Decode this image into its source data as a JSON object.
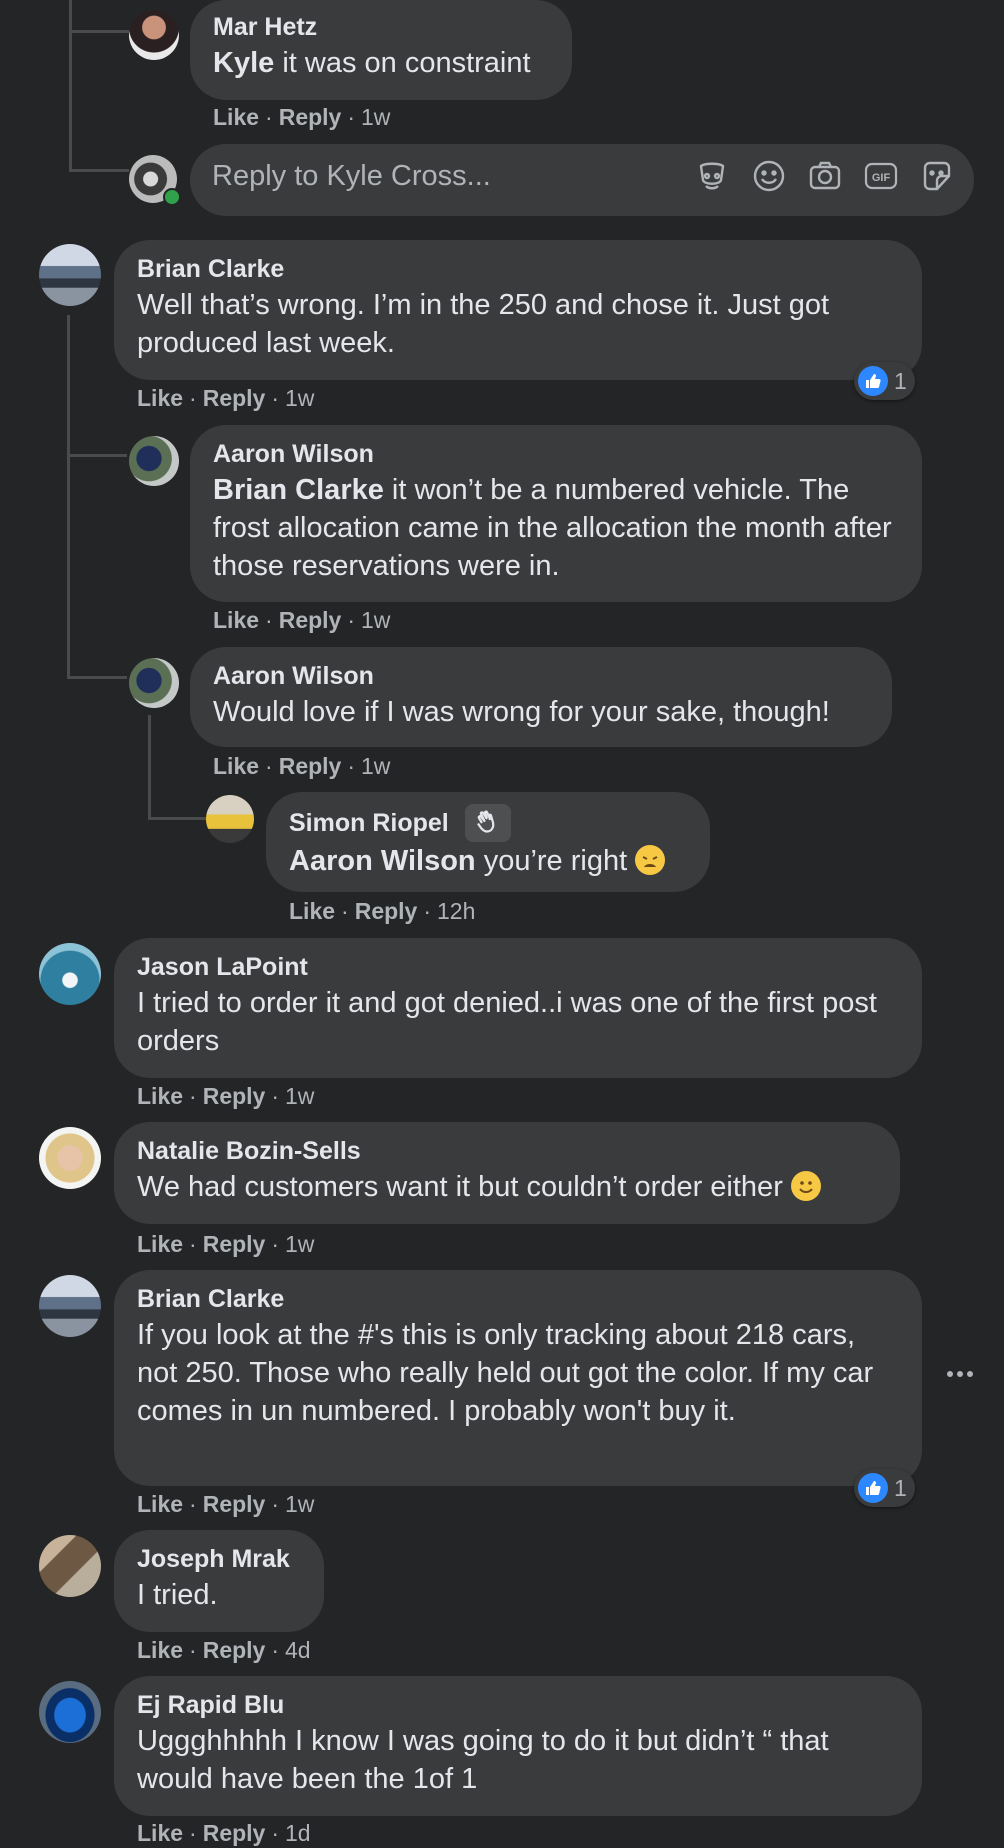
{
  "reply_box": {
    "placeholder": "Reply to Kyle Cross..."
  },
  "icons": [
    "avatar-icon",
    "emoji-icon",
    "camera-icon",
    "gif-icon",
    "sticker-icon",
    "like-icon",
    "more-icon"
  ],
  "colors": {
    "background": "#242526",
    "bubble": "#3a3b3c",
    "meta": "#b0b3b8",
    "accent": "#2d88ff"
  },
  "comments": [
    {
      "name": "Mar Hetz",
      "mention": "Kyle",
      "text": " it was on constraint",
      "meta": {
        "like": "Like",
        "reply": "Reply",
        "time": "1w"
      }
    },
    {
      "name": "Brian Clarke",
      "text": "Well that’s wrong. I’m in the 250 and chose it. Just got produced last week.",
      "meta": {
        "like": "Like",
        "reply": "Reply",
        "time": "1w"
      },
      "reactions": "1"
    },
    {
      "name": "Aaron Wilson",
      "mention": "Brian Clarke",
      "text": " it won’t be a numbered vehicle. The frost allocation came in the allocation the month after those reservations were in.",
      "meta": {
        "like": "Like",
        "reply": "Reply",
        "time": "1w"
      }
    },
    {
      "name": "Aaron Wilson",
      "text": "Would love if I was wrong for your sake, though!",
      "meta": {
        "like": "Like",
        "reply": "Reply",
        "time": "1w"
      }
    },
    {
      "name": "Simon Riopel",
      "mention": "Aaron Wilson",
      "text": " you’re right",
      "meta": {
        "like": "Like",
        "reply": "Reply",
        "time": "12h"
      }
    },
    {
      "name": "Jason LaPoint",
      "text": "I tried to order it and got denied..i was one of the first post orders",
      "meta": {
        "like": "Like",
        "reply": "Reply",
        "time": "1w"
      }
    },
    {
      "name": "Natalie Bozin-Sells",
      "text": "We had customers want it but couldn’t order either",
      "meta": {
        "like": "Like",
        "reply": "Reply",
        "time": "1w"
      }
    },
    {
      "name": "Brian Clarke",
      "text": "If you look at the #'s this is only tracking about 218 cars, not 250. Those who really held out got the color. If my car comes in un numbered. I probably won't buy it.",
      "meta": {
        "like": "Like",
        "reply": "Reply",
        "time": "1w"
      },
      "reactions": "1"
    },
    {
      "name": "Joseph Mrak",
      "text": "I tried.",
      "meta": {
        "like": "Like",
        "reply": "Reply",
        "time": "4d"
      }
    },
    {
      "name": "Ej Rapid Blu",
      "text": "Uggghhhhh I know I was going to do it but didn’t “ that would have been the 1of 1",
      "meta": {
        "like": "Like",
        "reply": "Reply",
        "time": "1d"
      }
    }
  ]
}
